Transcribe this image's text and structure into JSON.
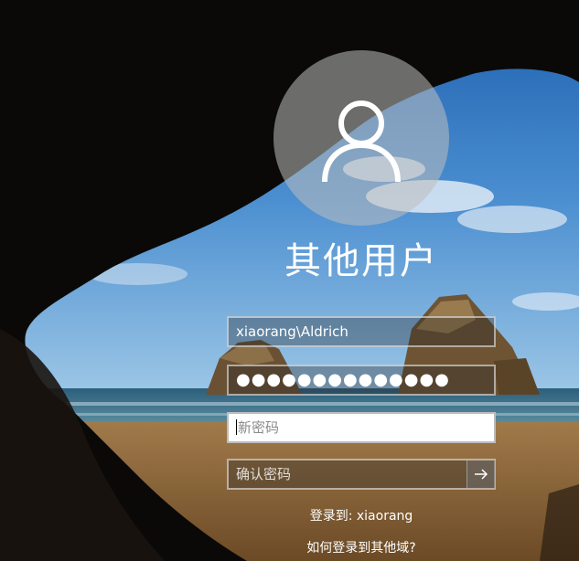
{
  "login": {
    "user_display_name": "其他用户",
    "username_value": "xiaorang\\Aldrich",
    "password_masked": "●●●●●●●●●●●●●●",
    "new_password_placeholder": "新密码",
    "confirm_password_placeholder": "确认密码",
    "sign_in_to": "登录到: xiaorang",
    "other_domain_link": "如何登录到其他域?"
  },
  "icons": {
    "avatar": "user-silhouette-icon",
    "submit": "arrow-right-icon"
  }
}
